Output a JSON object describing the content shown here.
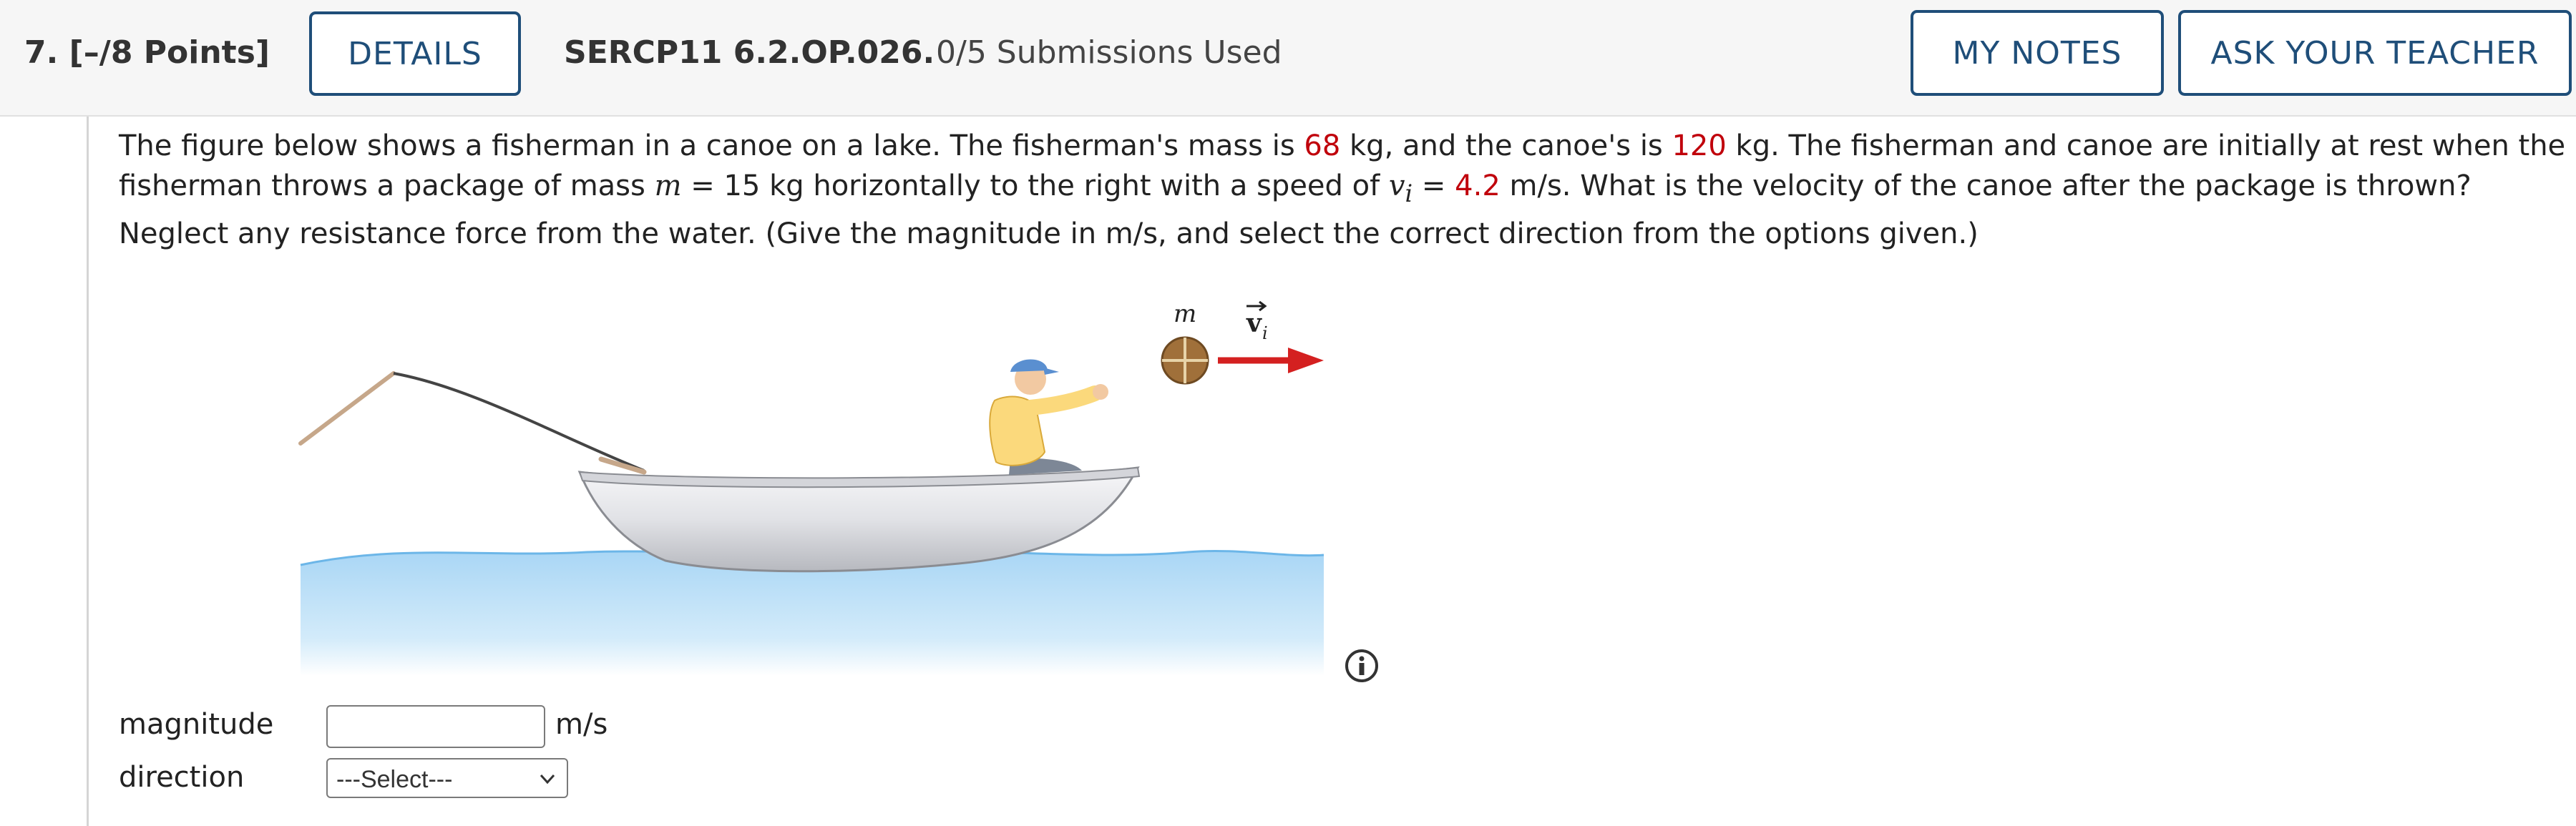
{
  "header": {
    "question_number": "7.",
    "points": "[–/8 Points]",
    "details_button": "DETAILS",
    "problem_code": "SERCP11 6.2.OP.026.",
    "submissions": "0/5 Submissions Used",
    "my_notes_button": "MY NOTES",
    "ask_teacher_button": "ASK YOUR TEACHER"
  },
  "question": {
    "t1": "The figure below shows a fisherman in a canoe on a lake. The fisherman's mass is ",
    "fisherman_mass": "68",
    "t2": " kg, and the canoe's is ",
    "canoe_mass": "120",
    "t3": " kg. The fisherman and canoe are initially at rest when the fisherman throws a package of mass ",
    "mass_var": "m",
    "t4": " = 15 kg horizontally to the right with a speed of ",
    "speed_var": "v",
    "speed_sub": "i",
    "t5": " = ",
    "speed_value": "4.2",
    "t6": " m/s. What is the velocity of the canoe after the package is thrown? Neglect any resistance force from the water. (Give the magnitude in m/s, and select the correct direction from the options given.)"
  },
  "figure": {
    "mass_label": "m",
    "velocity_label": "v",
    "velocity_sub": "i",
    "colors": {
      "arrow": "#d42020",
      "water": "#a9d6f5",
      "boat": "#e8e9ec",
      "package": "#a0703a"
    }
  },
  "answer": {
    "magnitude_label": "magnitude",
    "magnitude_value": "",
    "unit": "m/s",
    "direction_label": "direction",
    "direction_selected": "---Select---"
  }
}
